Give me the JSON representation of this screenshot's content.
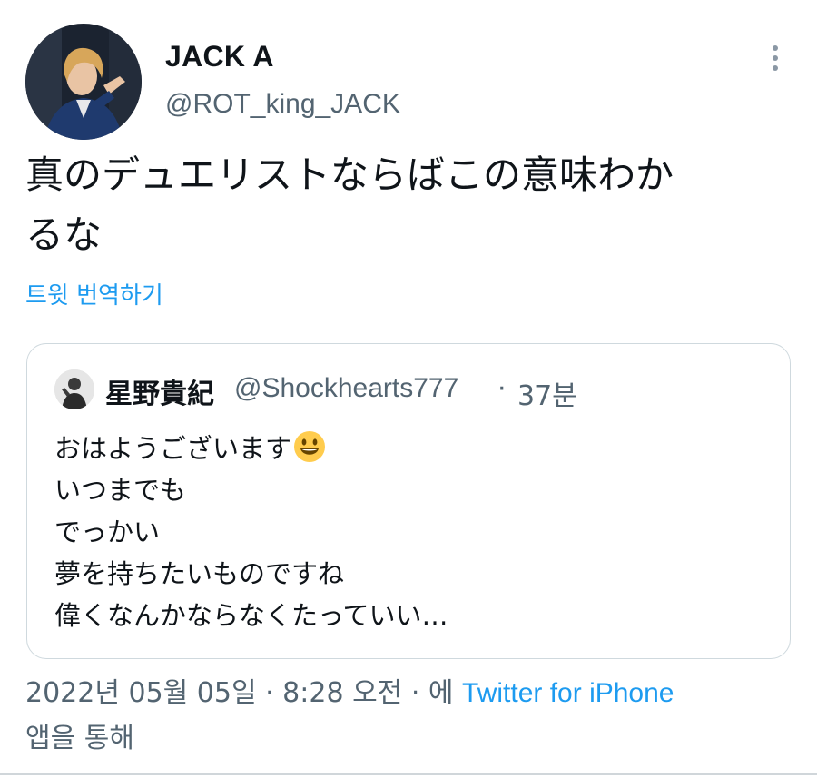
{
  "author": {
    "display_name": "JACK A",
    "handle": "@ROT_king_JACK",
    "avatar_icon": "profile-photo"
  },
  "more_icon": "more-vertical-icon",
  "tweet": {
    "text_line1": "真のデュエリストならばこの意味わか",
    "text_line2": "るな",
    "translate_label": "트윗 번역하기"
  },
  "quote": {
    "author_name": "星野貴紀",
    "author_handle": "@Shockhearts777",
    "separator": "·",
    "time": "37분",
    "lines": [
      "おはようございます",
      "いつまでも",
      "でっかい",
      "夢を持ちたいものですね",
      "偉くなんかならなくたっていい…"
    ],
    "emoji": "smiling-face-emoji"
  },
  "meta": {
    "timestamp": "2022년 05월 05일 · 8:28 오전 · 에",
    "source": "Twitter for iPhone",
    "suffix": "앱을 통해"
  },
  "colors": {
    "text": "#0f1419",
    "secondary": "#536471",
    "link": "#1d9bf0",
    "border": "#cfd9de"
  }
}
